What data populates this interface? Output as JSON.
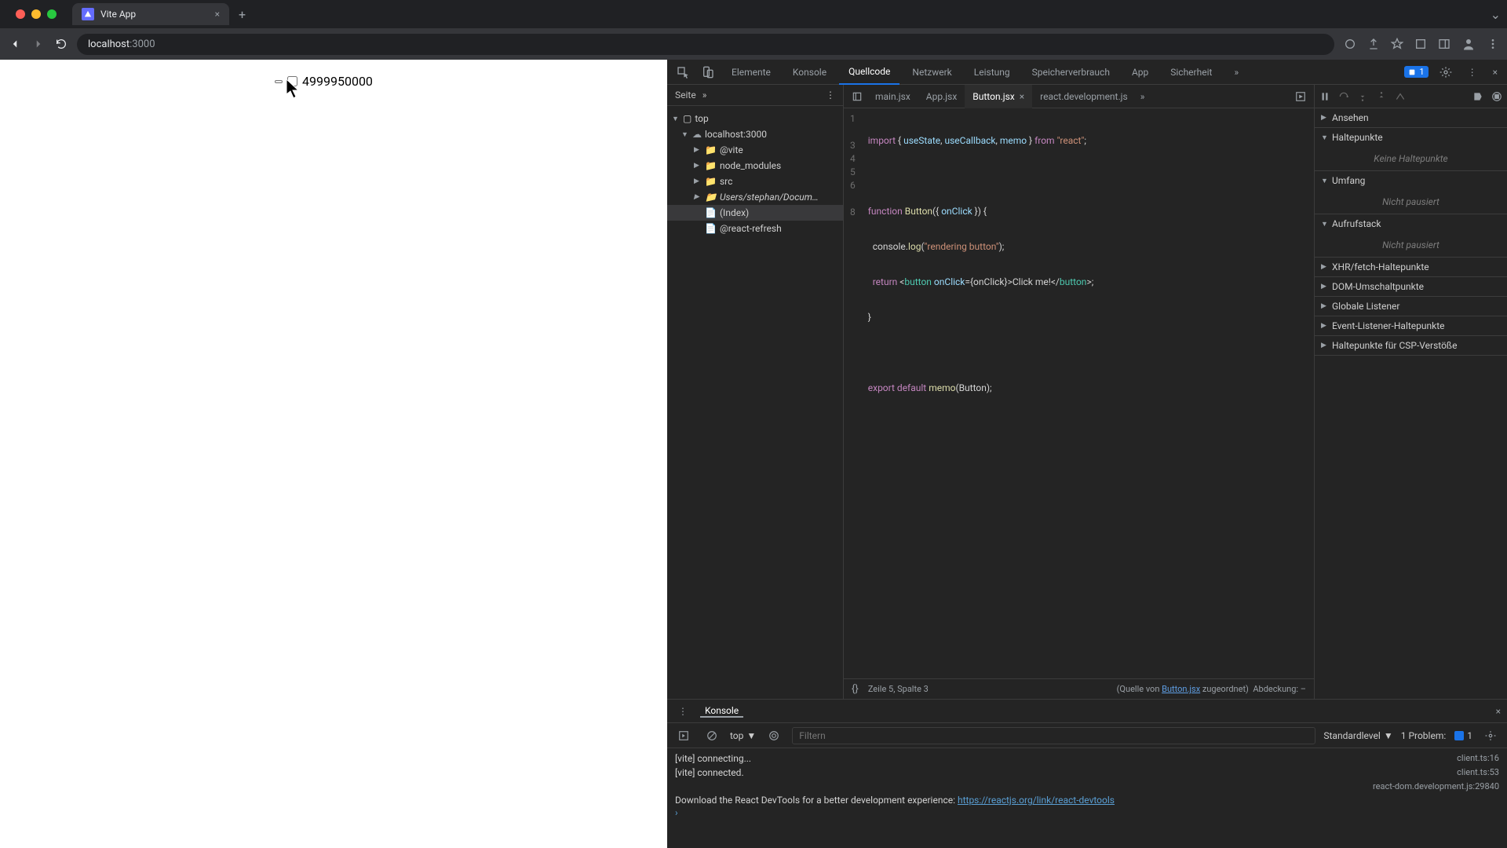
{
  "browser": {
    "tab_title": "Vite App",
    "url_host": "localhost",
    "url_port": ":3000"
  },
  "page": {
    "button_text": "",
    "number": "4999950000"
  },
  "devtools": {
    "tabs": [
      "Elemente",
      "Konsole",
      "Quellcode",
      "Netzwerk",
      "Leistung",
      "Speicherverbrauch",
      "App",
      "Sicherheit"
    ],
    "active_tab": "Quellcode",
    "issues_count": "1"
  },
  "sources": {
    "pane_tab": "Seite",
    "tree": {
      "top": "top",
      "host": "localhost:3000",
      "items": [
        "@vite",
        "node_modules",
        "src",
        "Users/stephan/Docum…",
        "(Index)",
        "@react-refresh"
      ]
    },
    "editor_tabs": [
      "main.jsx",
      "App.jsx",
      "Button.jsx",
      "react.development.js"
    ],
    "active_editor_tab": "Button.jsx",
    "code": {
      "l1": "import { useState, useCallback, memo } from \"react\";",
      "l3": "function Button({ onClick }) {",
      "l4": "  console.log(\"rendering button\");",
      "l5": "  return <button onClick={onClick}>Click me!</button>;",
      "l6": "}",
      "l8": "export default memo(Button);"
    },
    "status": {
      "pos": "Zeile 5, Spalte 3",
      "src_pre": "(Quelle von ",
      "src_link": "Button.jsx",
      "src_post": " zugeordnet)",
      "coverage_label": "Abdeckung: –"
    }
  },
  "debug": {
    "sections": {
      "watch": "Ansehen",
      "breakpoints": "Haltepunkte",
      "breakpoints_body": "Keine Haltepunkte",
      "scope": "Umfang",
      "scope_body": "Nicht pausiert",
      "callstack": "Aufrufstack",
      "callstack_body": "Nicht pausiert",
      "xhr": "XHR/fetch-Haltepunkte",
      "dom": "DOM-Umschaltpunkte",
      "global": "Globale Listener",
      "event": "Event-Listener-Haltepunkte",
      "csp": "Haltepunkte für CSP-Verstöße"
    }
  },
  "console": {
    "title": "Konsole",
    "context": "top",
    "filter_placeholder": "Filtern",
    "level": "Standardlevel",
    "problems_label": "1 Problem:",
    "problems_count": "1",
    "logs": [
      {
        "msg": "[vite] connecting...",
        "src": "client.ts:16"
      },
      {
        "msg": "[vite] connected.",
        "src": "client.ts:53"
      },
      {
        "msg_right_src": "react-dom.development.js:29840"
      },
      {
        "msg": "Download the React DevTools for a better development experience: ",
        "link": "https://reactjs.org/link/react-devtools"
      }
    ]
  }
}
